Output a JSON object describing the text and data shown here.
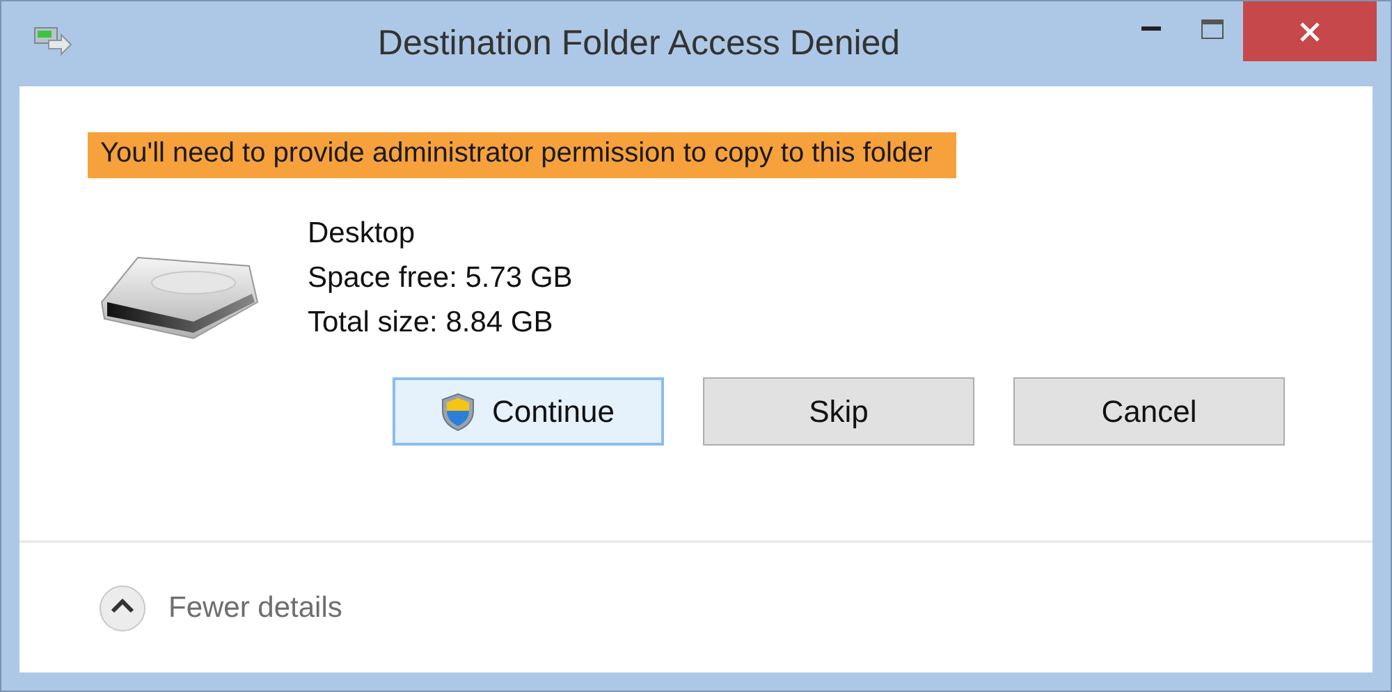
{
  "window": {
    "title": "Destination Folder Access Denied"
  },
  "message": {
    "text": "You'll need to provide administrator permission to copy to this folder",
    "highlighted": true
  },
  "location": {
    "name": "Desktop",
    "details": [
      "Space free: 5.73 GB",
      "Total size: 8.84 GB"
    ]
  },
  "buttons": [
    {
      "label": "Continue",
      "default": true,
      "shield": true
    },
    {
      "label": "Skip",
      "default": false,
      "shield": false
    },
    {
      "label": "Cancel",
      "default": false,
      "shield": false
    }
  ],
  "details_toggle": {
    "label": "Fewer details",
    "expanded": true
  }
}
